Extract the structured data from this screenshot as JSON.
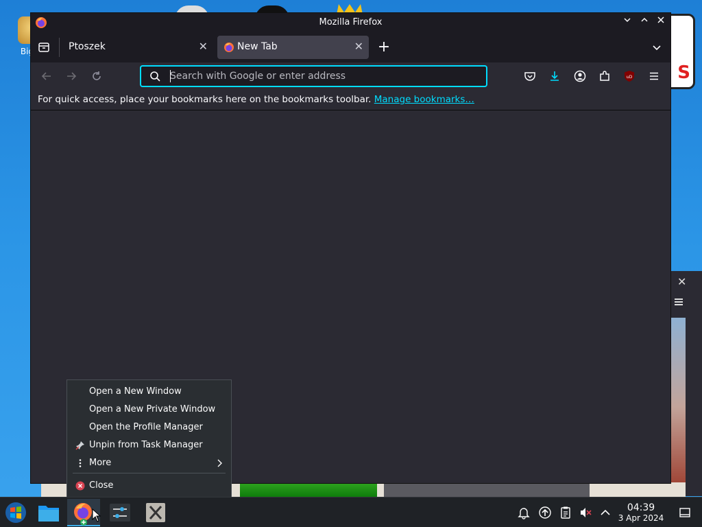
{
  "desktop": {
    "icon_label": "Big D",
    "sign_text": "S"
  },
  "window": {
    "title": "Mozilla Firefox"
  },
  "tabs": [
    {
      "label": "Ptoszek"
    },
    {
      "label": "New Tab"
    }
  ],
  "urlbar": {
    "placeholder": "Search with Google or enter address",
    "value": ""
  },
  "bookmarks_bar": {
    "message": "For quick access, place your bookmarks here on the bookmarks toolbar.",
    "link": "Manage bookmarks…"
  },
  "context_menu": {
    "items": [
      {
        "label": "Open a New Window",
        "icon": ""
      },
      {
        "label": "Open a New Private Window",
        "icon": ""
      },
      {
        "label": "Open the Profile Manager",
        "icon": ""
      },
      {
        "label": "Unpin from Task Manager",
        "icon": "unpin-icon"
      },
      {
        "label": "More",
        "icon": "more-vertical-icon"
      },
      {
        "label": "Close",
        "icon": "close-circle-icon"
      }
    ]
  },
  "taskbar": {
    "launchers": [
      "start-menu-icon",
      "file-manager-icon",
      "firefox-icon",
      "settings-icon",
      "terminal-icon"
    ],
    "tray": [
      "notifications-icon",
      "updates-icon",
      "clipboard-icon",
      "volume-muted-icon",
      "show-hidden-icon",
      "desktop-icon"
    ],
    "time": "04:39",
    "date": "3 Apr 2024"
  },
  "colors": {
    "accent": "#00ddff",
    "window_bg": "#2b2a33",
    "titlebar_bg": "#1c1b22",
    "menu_bg": "#2a2e32",
    "taskbar_bg": "#1f2226"
  }
}
